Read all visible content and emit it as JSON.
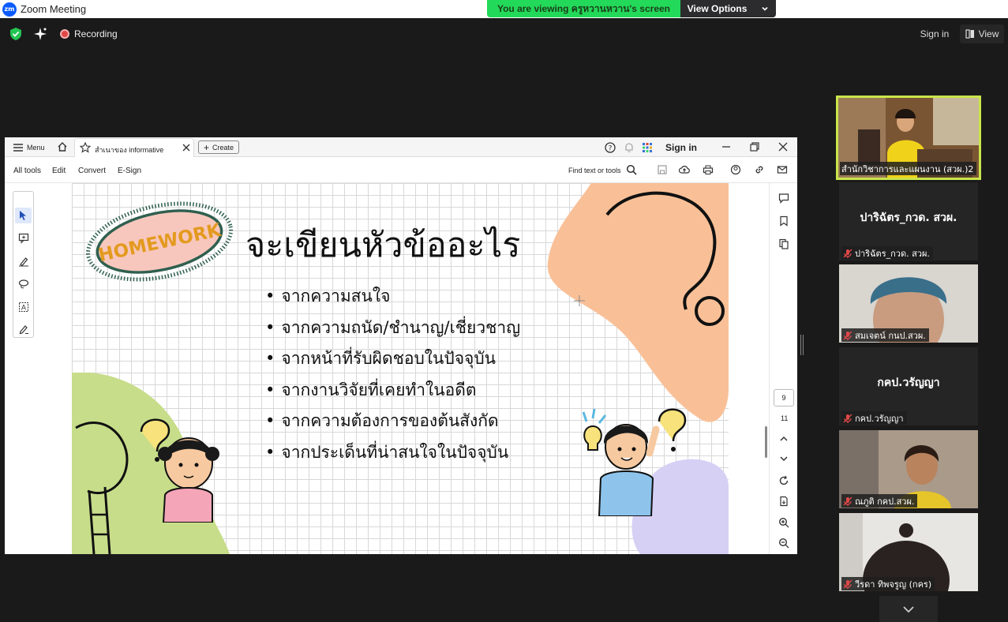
{
  "window": {
    "title": "Zoom Meeting",
    "logo": "zm"
  },
  "banner": {
    "viewing_text": "You are viewing ครูหวานหวาน's screen",
    "view_options": "View Options"
  },
  "toolbar": {
    "recording": "Recording",
    "sign_in": "Sign in",
    "view": "View"
  },
  "pdf": {
    "menu": "Menu",
    "tab_title": "สำเนาของ informative",
    "create": "Create",
    "sign_in": "Sign in",
    "tools": [
      "All tools",
      "Edit",
      "Convert",
      "E-Sign"
    ],
    "find": "Find text or tools",
    "page_current": "9",
    "page_total": "11"
  },
  "slide": {
    "badge": "HOMEWORK",
    "title": "จะเขียนหัวข้ออะไร",
    "bullets": [
      "จากความสนใจ",
      "จากความถนัด/ชำนาญ/เชี่ยวชาญ",
      "จากหน้าที่รับผิดชอบในปัจจุบัน",
      "จากงานวิจัยที่เคยทำในอดีต",
      "จากความต้องการของต้นสังกัด",
      "จากประเด็นที่น่าสนใจในปัจจุบัน"
    ]
  },
  "participants": [
    {
      "label": "สำนักวิชาการและแผนงาน (สวผ.)2",
      "video": true,
      "muted": false
    },
    {
      "big": "ปาริฉัตร_กวด. สวผ.",
      "label": "ปาริฉัตร_กวด. สวผ.",
      "video": false,
      "muted": true
    },
    {
      "label": "สมเจตน์ กนป.สวผ.",
      "video": true,
      "muted": true
    },
    {
      "big": "กคป.วรัญญา",
      "label": "กคป.วรัญญา",
      "video": false,
      "muted": true
    },
    {
      "label": "ณภูติ กคป.สวผ.",
      "video": true,
      "muted": true
    },
    {
      "label": "วีรดา ทิพจรูญ (กคร)",
      "video": true,
      "muted": true
    }
  ],
  "colors": {
    "zoom_green": "#23d959",
    "active_speaker": "#c9e54b",
    "zoom_blue": "#0b5cff"
  }
}
